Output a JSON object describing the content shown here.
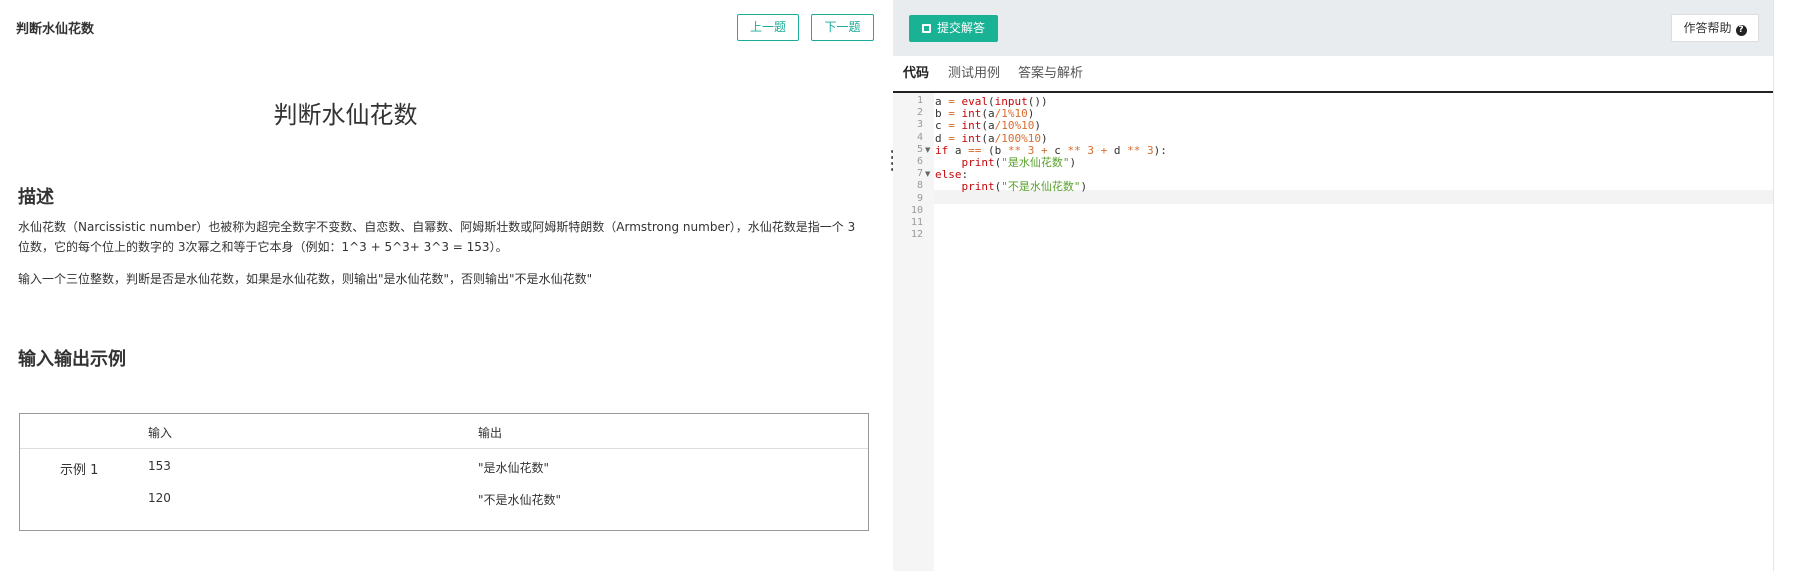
{
  "breadcrumb": "判断水仙花数",
  "nav": {
    "prev": "上一题",
    "next": "下一题"
  },
  "problem": {
    "title": "判断水仙花数",
    "desc_heading": "描述",
    "desc_p1": "水仙花数（Narcissistic number）也被称为超完全数字不变数、自恋数、自幂数、阿姆斯壮数或阿姆斯特朗数（Armstrong number），水仙花数是指一个 3 位数，它的每个位上的数字的 3次幂之和等于它本身（例如：1^3 + 5^3+ 3^3 = 153）。",
    "desc_p2": "输入一个三位整数，判断是否是水仙花数，如果是水仙花数，则输出\"是水仙花数\"，否则输出\"不是水仙花数\"",
    "io_heading": "输入输出示例",
    "io_table": {
      "headers": [
        "输入",
        "输出"
      ],
      "example_label": "示例 1",
      "rows": [
        {
          "input": "153",
          "output": "\"是水仙花数\""
        },
        {
          "input": "120",
          "output": "\"不是水仙花数\""
        }
      ]
    }
  },
  "editor": {
    "submit_label": "提交解答",
    "help_label": "作答帮助",
    "tabs": [
      "代码",
      "测试用例",
      "答案与解析"
    ],
    "active_tab": "代码",
    "line_numbers": [
      "1",
      "2",
      "3",
      "4",
      "5",
      "6",
      "7",
      "8",
      "9",
      "10",
      "11",
      "12"
    ],
    "code": [
      "a = eval(input())",
      "b = int(a/1%10)",
      "c = int(a/10%10)",
      "d = int(a/100%10)",
      "if a == (b ** 3 + c ** 3 + d ** 3):",
      "    print(\"是水仙花数\")",
      "else:",
      "    print(\"不是水仙花数\")",
      "",
      "",
      "",
      ""
    ]
  },
  "colors": {
    "accent": "#19b295",
    "keyword": "#c5060b",
    "number": "#d86c2e",
    "string": "#5aa02c"
  },
  "icons": {
    "submit": "save-icon",
    "help": "question-circle-icon"
  }
}
